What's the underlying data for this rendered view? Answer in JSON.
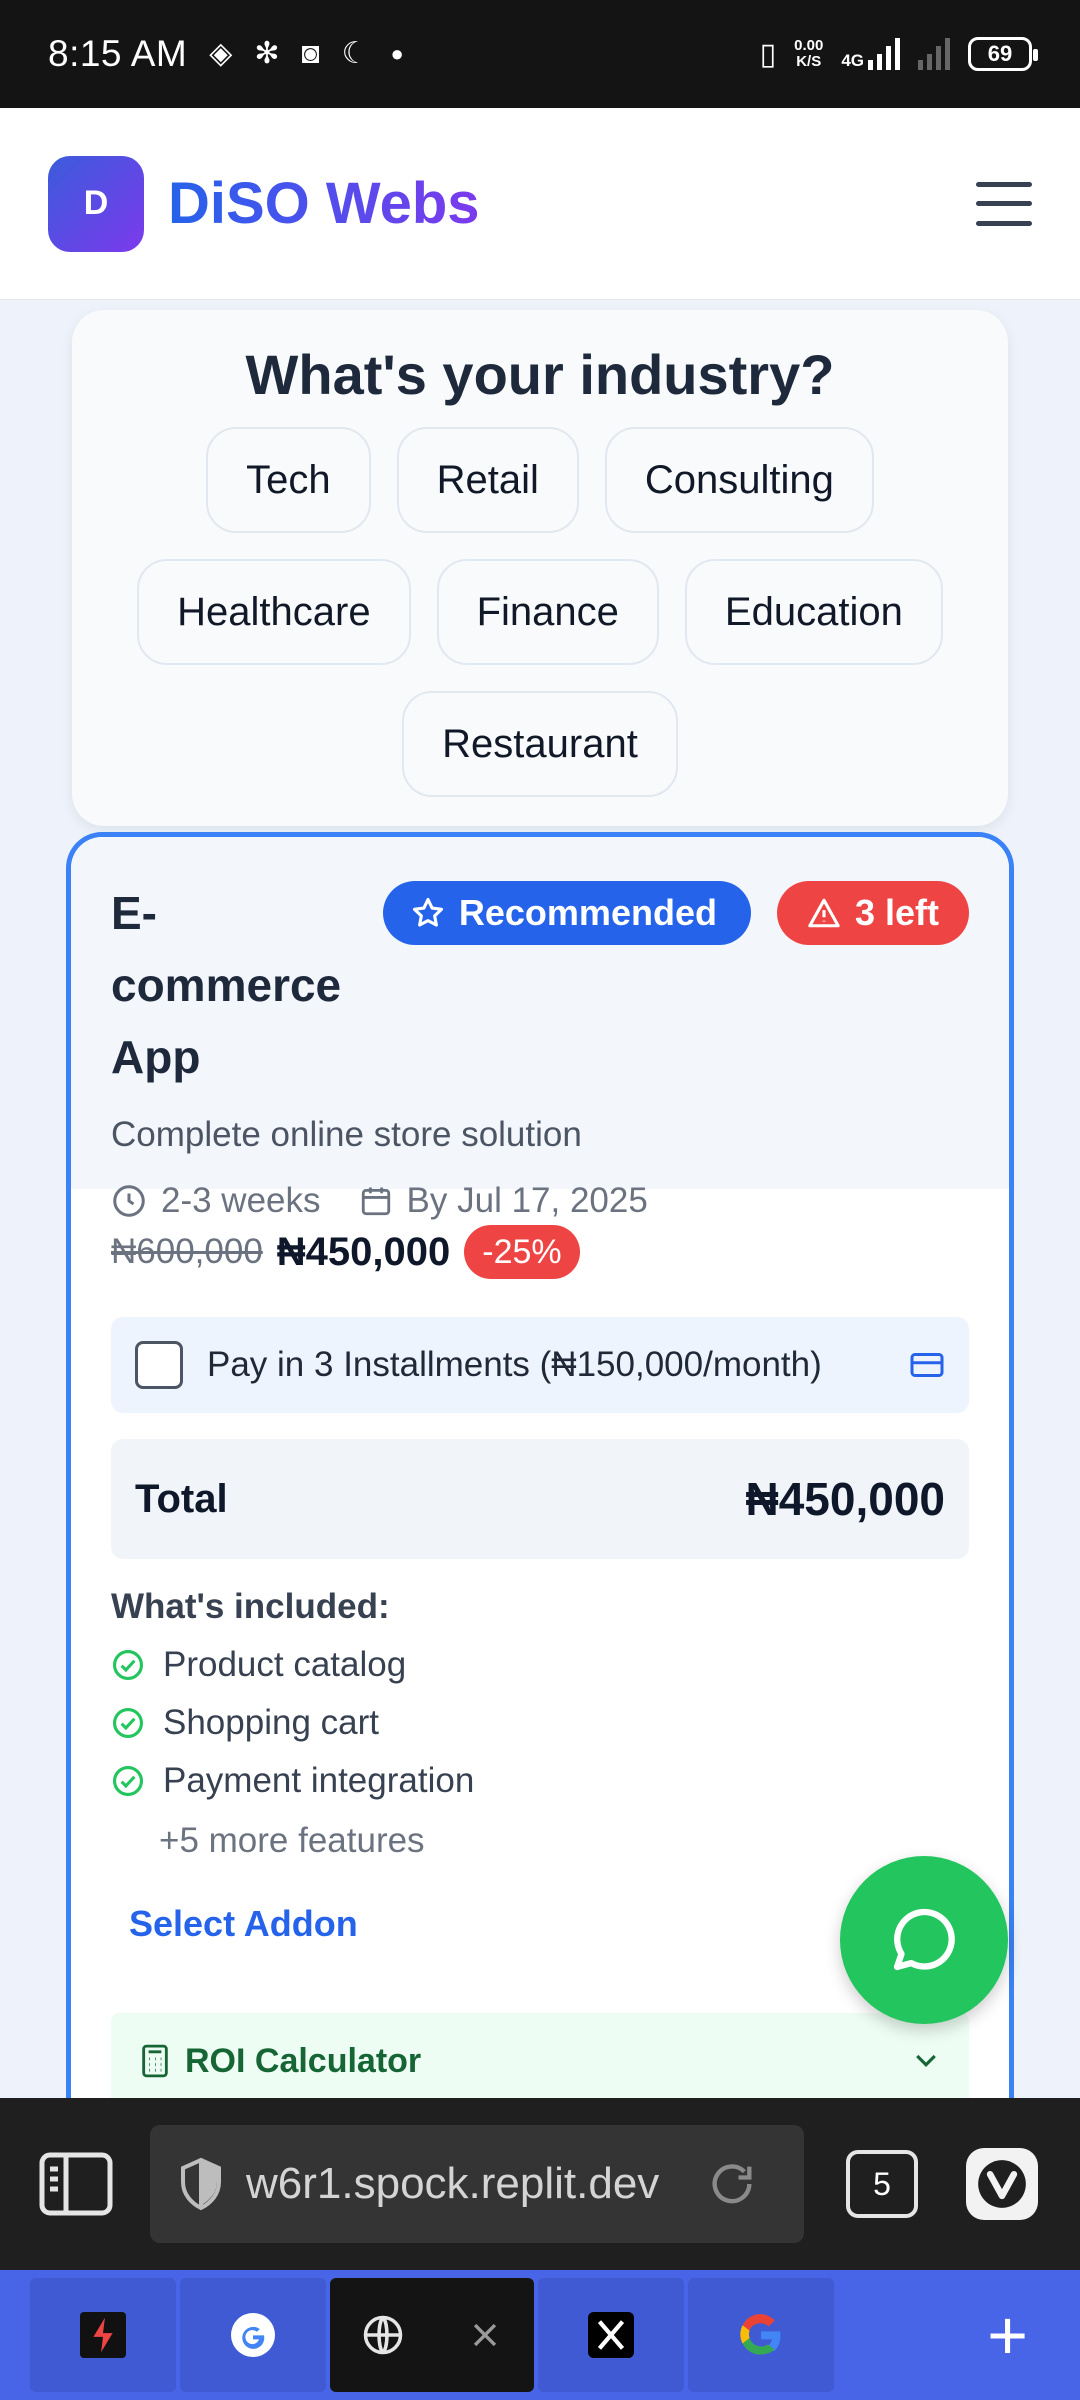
{
  "status_bar": {
    "time": "8:15 AM",
    "net_speed_value": "0.00",
    "net_speed_unit": "K/S",
    "network": "4G",
    "battery": "69"
  },
  "header": {
    "logo_letter": "D",
    "brand": "DiSO Webs"
  },
  "industry": {
    "title": "What's your industry?",
    "row1": [
      "Tech",
      "Retail",
      "Consulting"
    ],
    "row2": [
      "Healthcare",
      "Finance",
      "Education"
    ],
    "row3": [
      "Restaurant"
    ]
  },
  "package": {
    "title": "E-commerce App",
    "badge_recommended": "Recommended",
    "badge_stock": "3 left",
    "description": "Complete online store solution",
    "duration": "2-3 weeks",
    "deadline": "By Jul 17, 2025",
    "old_price": "₦600,000",
    "new_price": "₦450,000",
    "discount": "-25%",
    "installment_label": "Pay in 3 Installments (₦150,000/month)",
    "installment_checked": false,
    "total_label": "Total",
    "total_value": "₦450,000",
    "included_title": "What's included:",
    "features": [
      "Product catalog",
      "Shopping cart",
      "Payment integration"
    ],
    "more_features": "+5 more features",
    "addon_link": "Select Addon",
    "roi_label": "ROI Calculator"
  },
  "browser": {
    "url": "w6r1.spock.replit.dev",
    "tab_count": "5"
  },
  "colors": {
    "primary": "#2563eb",
    "accent_purple": "#7c3aed",
    "danger": "#ef4444",
    "success": "#22c55e",
    "tabbar": "#4865e8"
  }
}
